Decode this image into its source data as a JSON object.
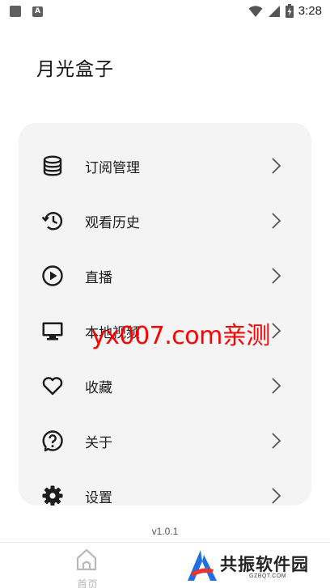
{
  "status_bar": {
    "time": "3:28",
    "left_icons": [
      "square-notification-icon",
      "a-notification-icon"
    ],
    "right_icons": [
      "wifi-icon",
      "signal-icon",
      "battery-charging-icon"
    ],
    "a_glyph": "A"
  },
  "app": {
    "title": "月光盒子"
  },
  "menu": {
    "items": [
      {
        "label": "订阅管理",
        "icon": "database-icon"
      },
      {
        "label": "观看历史",
        "icon": "history-icon"
      },
      {
        "label": "直播",
        "icon": "play-circle-icon"
      },
      {
        "label": "本地视频",
        "icon": "monitor-icon"
      },
      {
        "label": "收藏",
        "icon": "heart-icon"
      },
      {
        "label": "关于",
        "icon": "help-icon"
      },
      {
        "label": "设置",
        "icon": "gear-icon"
      }
    ]
  },
  "watermark": {
    "text": "yx007.com亲测",
    "color": "#ff0000"
  },
  "version": "v1.0.1",
  "bottom_nav": {
    "home_label": "首页"
  },
  "brand": {
    "name": "共振软件园",
    "url": "GZBQT.COM"
  },
  "colors": {
    "card_background": "#f4f4f4",
    "icon": "#1c1c1c",
    "chevron": "#555555",
    "nav_inactive": "#b8b8b8",
    "brand_blue": "#1e6ee6"
  }
}
